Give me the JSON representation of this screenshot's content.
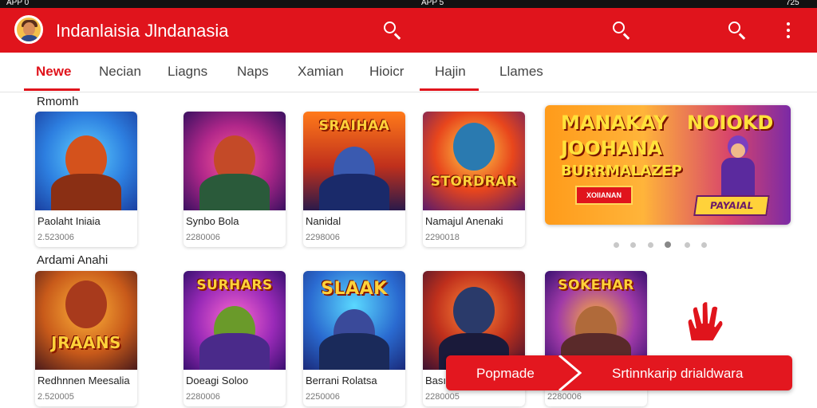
{
  "status": {
    "left": "APP 0",
    "mid": "APP 5",
    "right": "725"
  },
  "header": {
    "title": "Indanlaisia Jlndanasia"
  },
  "tabs": [
    {
      "label": "Newe",
      "active": true
    },
    {
      "label": "Necian",
      "active": false
    },
    {
      "label": "Liagns",
      "active": false
    },
    {
      "label": "Naps",
      "active": false
    },
    {
      "label": "Xamian",
      "active": false
    },
    {
      "label": "Hioicr",
      "active": false
    },
    {
      "label": "Hajin",
      "active": false,
      "underlined": true
    },
    {
      "label": "Llames",
      "active": false
    }
  ],
  "sections": [
    {
      "title": "Rmomh",
      "cards": [
        {
          "name": "Paolaht Iniaia",
          "meta": "2.523006",
          "logo": ""
        },
        {
          "name": "Synbo Bola",
          "meta": "2280006",
          "logo": ""
        },
        {
          "name": "Nanidal",
          "meta": "2298006",
          "logo": "SRAIHAA"
        },
        {
          "name": "Namajul Anenaki",
          "meta": "2290018",
          "logo": "STORDRAR"
        }
      ]
    },
    {
      "title": "Ardami Anahi",
      "cards": [
        {
          "name": "Redhnnen Meesalia",
          "meta": "2.520005",
          "logo": "JRAANS"
        },
        {
          "name": "Doeagi Soloo",
          "meta": "2280006",
          "logo": "SURHARS"
        },
        {
          "name": "Berrani Rolatsa",
          "meta": "2250006",
          "logo": "SLAAK"
        },
        {
          "name": "Bası",
          "meta": "2280005",
          "logo": ""
        },
        {
          "name": "",
          "meta": "2280006",
          "logo": "SOKEHAR"
        }
      ]
    }
  ],
  "banner": {
    "line1": "MANAKAY",
    "line1b": "NOIOKD",
    "line2": "JOOHANA",
    "line3": "BURRMALAZEP",
    "button": "XOIIANAN",
    "sub": "PAYAIAL",
    "page_count": 6,
    "active_index": 3
  },
  "popup": {
    "left": "Popmade",
    "right": "Srtinnkarip drialdwara"
  },
  "colors": {
    "accent": "#e0141c",
    "bg": "#ffffff"
  }
}
